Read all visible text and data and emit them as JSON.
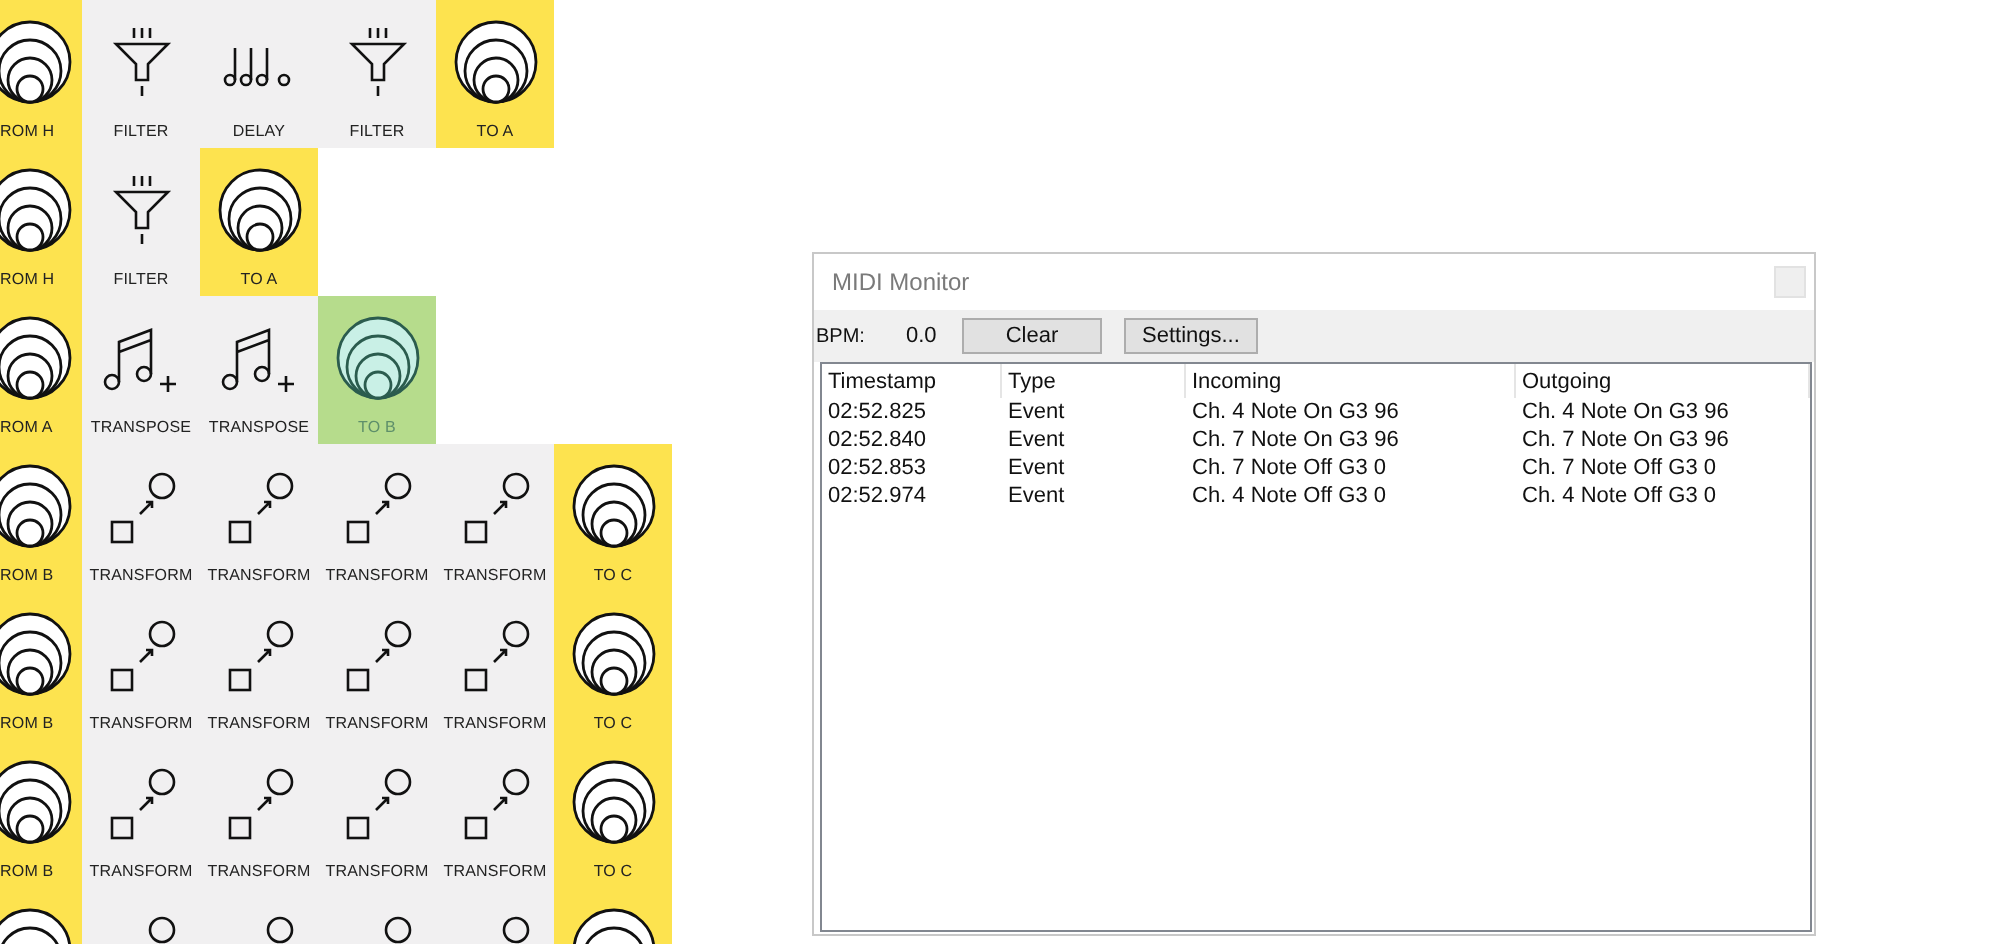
{
  "grid": {
    "rows": [
      {
        "cells": [
          {
            "kind": "source",
            "label": "ROM H",
            "selected": false
          },
          {
            "kind": "filter",
            "label": "FILTER",
            "selected": false
          },
          {
            "kind": "delay",
            "label": "DELAY",
            "selected": false
          },
          {
            "kind": "filter",
            "label": "FILTER",
            "selected": false
          },
          {
            "kind": "destination",
            "label": "TO A",
            "selected": false
          }
        ]
      },
      {
        "cells": [
          {
            "kind": "source",
            "label": "ROM H",
            "selected": false
          },
          {
            "kind": "filter",
            "label": "FILTER",
            "selected": false
          },
          {
            "kind": "destination",
            "label": "TO A",
            "selected": false
          }
        ]
      },
      {
        "cells": [
          {
            "kind": "source",
            "label": "ROM A",
            "selected": false
          },
          {
            "kind": "transpose",
            "label": "TRANSPOSE",
            "selected": false
          },
          {
            "kind": "transpose",
            "label": "TRANSPOSE",
            "selected": false
          },
          {
            "kind": "destination",
            "label": "TO B",
            "selected": true
          }
        ]
      },
      {
        "cells": [
          {
            "kind": "source",
            "label": "ROM B",
            "selected": false
          },
          {
            "kind": "transform",
            "label": "TRANSFORM",
            "selected": false
          },
          {
            "kind": "transform",
            "label": "TRANSFORM",
            "selected": false
          },
          {
            "kind": "transform",
            "label": "TRANSFORM",
            "selected": false
          },
          {
            "kind": "transform",
            "label": "TRANSFORM",
            "selected": false
          },
          {
            "kind": "destination",
            "label": "TO C",
            "selected": false
          }
        ]
      },
      {
        "cells": [
          {
            "kind": "source",
            "label": "ROM B",
            "selected": false
          },
          {
            "kind": "transform",
            "label": "TRANSFORM",
            "selected": false
          },
          {
            "kind": "transform",
            "label": "TRANSFORM",
            "selected": false
          },
          {
            "kind": "transform",
            "label": "TRANSFORM",
            "selected": false
          },
          {
            "kind": "transform",
            "label": "TRANSFORM",
            "selected": false
          },
          {
            "kind": "destination",
            "label": "TO C",
            "selected": false
          }
        ]
      },
      {
        "cells": [
          {
            "kind": "source",
            "label": "ROM B",
            "selected": false
          },
          {
            "kind": "transform",
            "label": "TRANSFORM",
            "selected": false
          },
          {
            "kind": "transform",
            "label": "TRANSFORM",
            "selected": false
          },
          {
            "kind": "transform",
            "label": "TRANSFORM",
            "selected": false
          },
          {
            "kind": "transform",
            "label": "TRANSFORM",
            "selected": false
          },
          {
            "kind": "destination",
            "label": "TO C",
            "selected": false
          }
        ]
      },
      {
        "cells": [
          {
            "kind": "source",
            "selected": false
          },
          {
            "kind": "transform",
            "selected": false
          },
          {
            "kind": "transform",
            "selected": false
          },
          {
            "kind": "transform",
            "selected": false
          },
          {
            "kind": "transform",
            "selected": false
          },
          {
            "kind": "destination",
            "selected": false
          }
        ]
      }
    ]
  },
  "midi_monitor": {
    "title": "MIDI Monitor",
    "bpm_label": "BPM:",
    "bpm_value": "0.0",
    "buttons": [
      "Clear",
      "Settings..."
    ],
    "table": {
      "columns": [
        "Timestamp",
        "Type",
        "Incoming",
        "Outgoing"
      ],
      "rows": [
        [
          "02:52.825",
          "Event",
          "Ch. 4 Note On G3 96",
          "Ch. 4 Note On G3 96"
        ],
        [
          "02:52.840",
          "Event",
          "Ch. 7 Note On G3 96",
          "Ch. 7 Note On G3 96"
        ],
        [
          "02:52.853",
          "Event",
          "Ch. 7 Note Off G3 0",
          "Ch. 7 Note Off G3 0"
        ],
        [
          "02:52.974",
          "Event",
          "Ch. 4 Note Off G3 0",
          "Ch. 4 Note Off G3 0"
        ]
      ]
    }
  }
}
